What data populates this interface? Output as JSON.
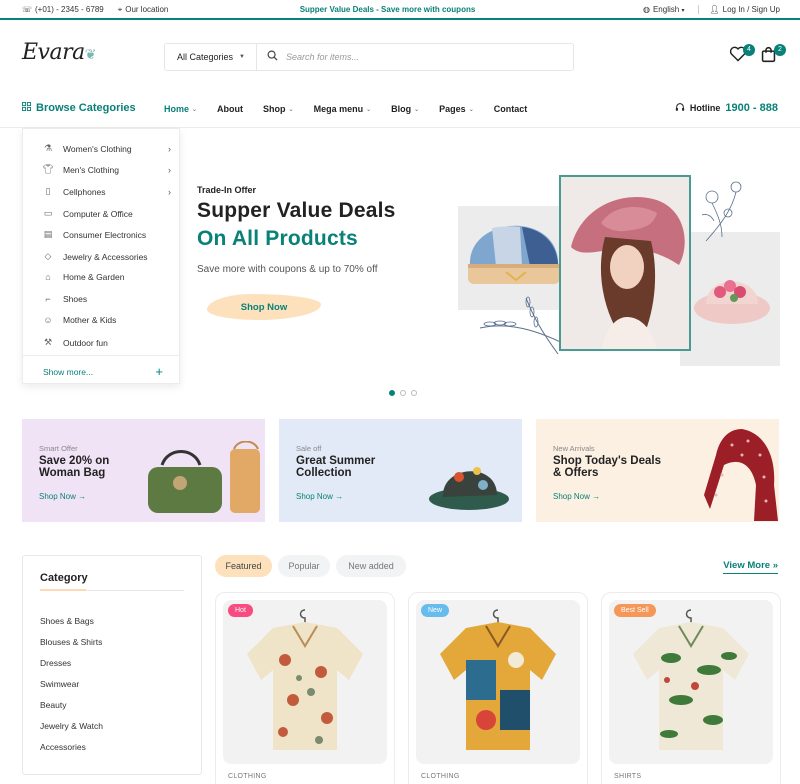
{
  "topbar": {
    "phone": "(+01) - 2345 - 6789",
    "location": "Our location",
    "promo": "Supper Value Deals - Save more with coupons",
    "language": "English",
    "auth": "Log In / Sign Up"
  },
  "header": {
    "logo": "Evara",
    "search": {
      "category": "All Categories",
      "placeholder": "Search for items..."
    },
    "wishlist_count": "4",
    "cart_count": "2"
  },
  "nav": {
    "browse": "Browse Categories",
    "items": [
      "Home",
      "About",
      "Shop",
      "Mega menu",
      "Blog",
      "Pages",
      "Contact"
    ],
    "hotline_label": "Hotline",
    "hotline_number": "1900 - 888"
  },
  "categories_menu": {
    "items": [
      {
        "label": "Women's Clothing",
        "icon": "dress-icon"
      },
      {
        "label": "Men's Clothing",
        "icon": "shirt-icon"
      },
      {
        "label": "Cellphones",
        "icon": "phone-icon"
      },
      {
        "label": "Computer & Office",
        "icon": "monitor-icon"
      },
      {
        "label": "Consumer Electronics",
        "icon": "electronics-icon"
      },
      {
        "label": "Jewelry & Accessories",
        "icon": "diamond-icon"
      },
      {
        "label": "Home & Garden",
        "icon": "home-icon"
      },
      {
        "label": "Shoes",
        "icon": "shoe-icon"
      },
      {
        "label": "Mother & Kids",
        "icon": "baby-icon"
      },
      {
        "label": "Outdoor fun",
        "icon": "outdoor-icon"
      }
    ],
    "show_more": "Show more..."
  },
  "hero": {
    "kicker": "Trade-In Offer",
    "line1": "Supper Value Deals",
    "line2": "On All Products",
    "text": "Save more with coupons & up to 70% off",
    "button": "Shop Now"
  },
  "promos": [
    {
      "kicker": "Smart Offer",
      "title": "Save 20% on Woman Bag",
      "link": "Shop Now →",
      "bg": "#f1e3f6"
    },
    {
      "kicker": "Sale off",
      "title": "Great Summer Collection",
      "link": "Shop Now →",
      "bg": "#e2eaf8"
    },
    {
      "kicker": "New Arrivals",
      "title": "Shop Today's Deals & Offers",
      "link": "Shop Now →",
      "bg": "#fbf0e2"
    }
  ],
  "sidebar": {
    "title": "Category",
    "items": [
      "Shoes & Bags",
      "Blouses & Shirts",
      "Dresses",
      "Swimwear",
      "Beauty",
      "Jewelry & Watch",
      "Accessories"
    ]
  },
  "tabs": [
    "Featured",
    "Popular",
    "New added"
  ],
  "view_more": "View More",
  "products": [
    {
      "badge": "Hot",
      "badge_color": "#f74b81",
      "category": "CLOTHING"
    },
    {
      "badge": "New",
      "badge_color": "#67bcee",
      "category": "CLOTHING"
    },
    {
      "badge": "Best Sell",
      "badge_color": "#f59758",
      "category": "SHIRTS"
    }
  ],
  "colors": {
    "brand": "#088178",
    "accent_peach": "#fde1bd"
  }
}
